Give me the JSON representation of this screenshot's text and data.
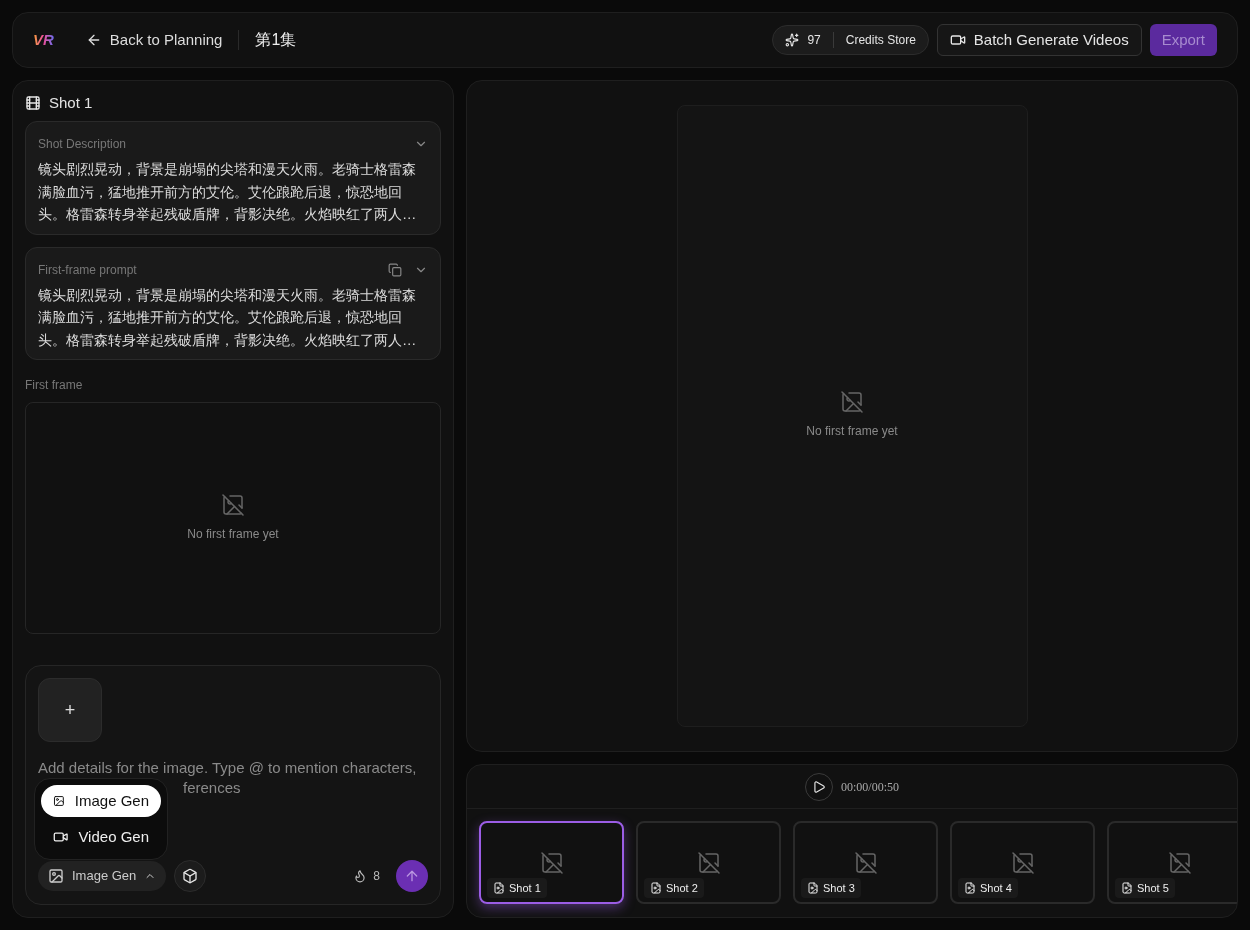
{
  "header": {
    "logo": "VR",
    "back_label": "Back to Planning",
    "episode_title": "第1集",
    "credits": "97",
    "credits_store": "Credits Store",
    "batch_button": "Batch Generate Videos",
    "export_button": "Export"
  },
  "shot_panel": {
    "title": "Shot 1",
    "sections": [
      {
        "label": "Shot Description",
        "text": "镜头剧烈晃动，背景是崩塌的尖塔和漫天火雨。老骑士格雷森满脸血污，猛地推开前方的艾伦。艾伦踉跄后退，惊恐地回头。格雷森转身举起残破盾牌，背影决绝。火焰映红了两人…",
        "copyable": false
      },
      {
        "label": "First-frame prompt",
        "text": "镜头剧烈晃动，背景是崩塌的尖塔和漫天火雨。老骑士格雷森满脸血污，猛地推开前方的艾伦。艾伦踉跄后退，惊恐地回头。格雷森转身举起残破盾牌，背影决绝。火焰映红了两人…",
        "copyable": true
      }
    ],
    "first_frame_label": "First frame",
    "empty_text": "No first frame yet"
  },
  "composer": {
    "add_button": "+",
    "placeholder": "Add details for the image. Type @ to mention characters,",
    "placeholder_continued": "ferences",
    "menu": [
      {
        "label": "Image Gen",
        "kind": "image",
        "selected": true
      },
      {
        "label": "Video Gen",
        "kind": "video",
        "selected": false
      }
    ],
    "mode_label": "Image Gen",
    "cost": "8"
  },
  "preview": {
    "empty_text": "No first frame yet"
  },
  "timeline": {
    "time": "00:00/00:50",
    "shots": [
      {
        "label": "Shot 1",
        "selected": true
      },
      {
        "label": "Shot 2",
        "selected": false
      },
      {
        "label": "Shot 3",
        "selected": false
      },
      {
        "label": "Shot 4",
        "selected": false
      },
      {
        "label": "Shot 5",
        "selected": false
      }
    ]
  }
}
